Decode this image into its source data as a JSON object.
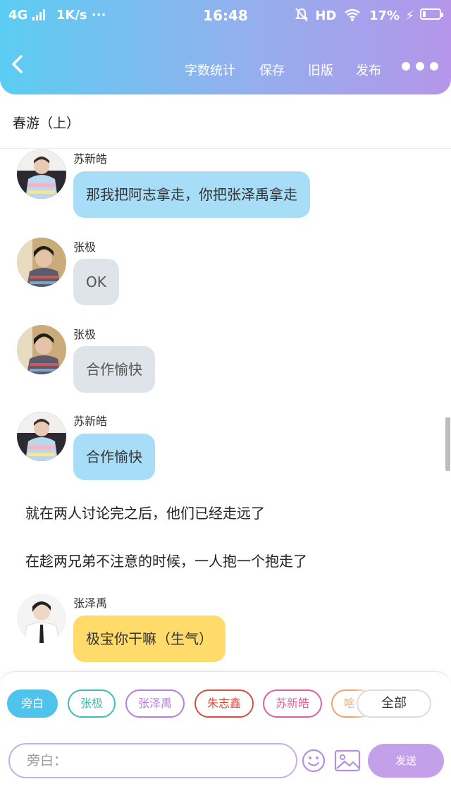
{
  "status_bar": {
    "network": "4G",
    "speed": "1K/s ···",
    "time": "16:48",
    "hd": "HD",
    "battery": "17%",
    "battery_level": 0.17
  },
  "header": {
    "word_count": "字数统计",
    "save": "保存",
    "old_version": "旧版",
    "publish": "发布"
  },
  "story_title": "春游（上）",
  "messages": [
    {
      "speaker": "苏新皓",
      "text": "那我把阿志拿走，你把张泽禹拿走"
    },
    {
      "speaker": "张极",
      "text": "OK"
    },
    {
      "speaker": "张极",
      "text": "合作愉快"
    },
    {
      "speaker": "苏新皓",
      "text": "合作愉快"
    }
  ],
  "narrations": [
    "就在两人讨论完之后，他们已经走远了",
    "在趁两兄弟不注意的时候，一人抱一个抱走了"
  ],
  "last_message": {
    "speaker": "张泽禹",
    "text": "极宝你干嘛（生气）"
  },
  "characters": [
    {
      "label": "旁白",
      "color": "#4fc3ec",
      "active": true
    },
    {
      "label": "张极",
      "color": "#3fbfb0"
    },
    {
      "label": "张泽禹",
      "color": "#b57fdc"
    },
    {
      "label": "朱志鑫",
      "color": "#d8503d"
    },
    {
      "label": "苏新皓",
      "color": "#e0609c"
    },
    {
      "label": "啥",
      "color": "#f0a36a"
    }
  ],
  "all_button": "全部",
  "input": {
    "placeholder": "旁白："
  },
  "send_label": "发送"
}
